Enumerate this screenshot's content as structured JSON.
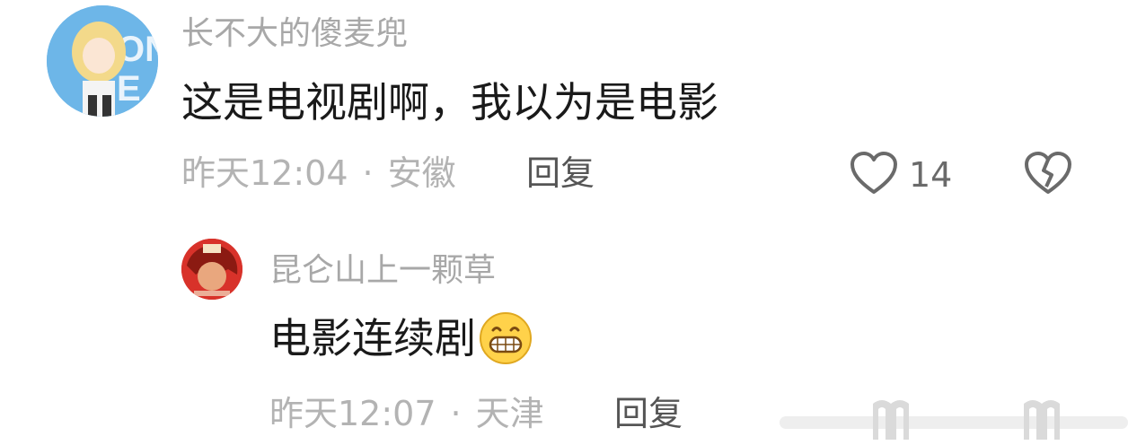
{
  "comment": {
    "username": "长不大的傻麦兜",
    "content": "这是电视剧啊，我以为是电影",
    "time": "昨天12:04",
    "separator": "·",
    "location": "安徽",
    "reply_label": "回复",
    "like_count": "14",
    "like_icon": "heart-outline-icon",
    "dislike_icon": "broken-heart-icon"
  },
  "reply": {
    "username": "昆仑山上一颗草",
    "content": "电影连续剧",
    "emoji": "grinning-face-emoji",
    "time": "昨天12:07",
    "separator": "·",
    "location": "天津",
    "reply_label": "回复"
  },
  "colors": {
    "username": "#a8a8a8",
    "content": "#1a1a1a",
    "meta": "#b3b3b3",
    "icon": "#6a6a6a"
  }
}
